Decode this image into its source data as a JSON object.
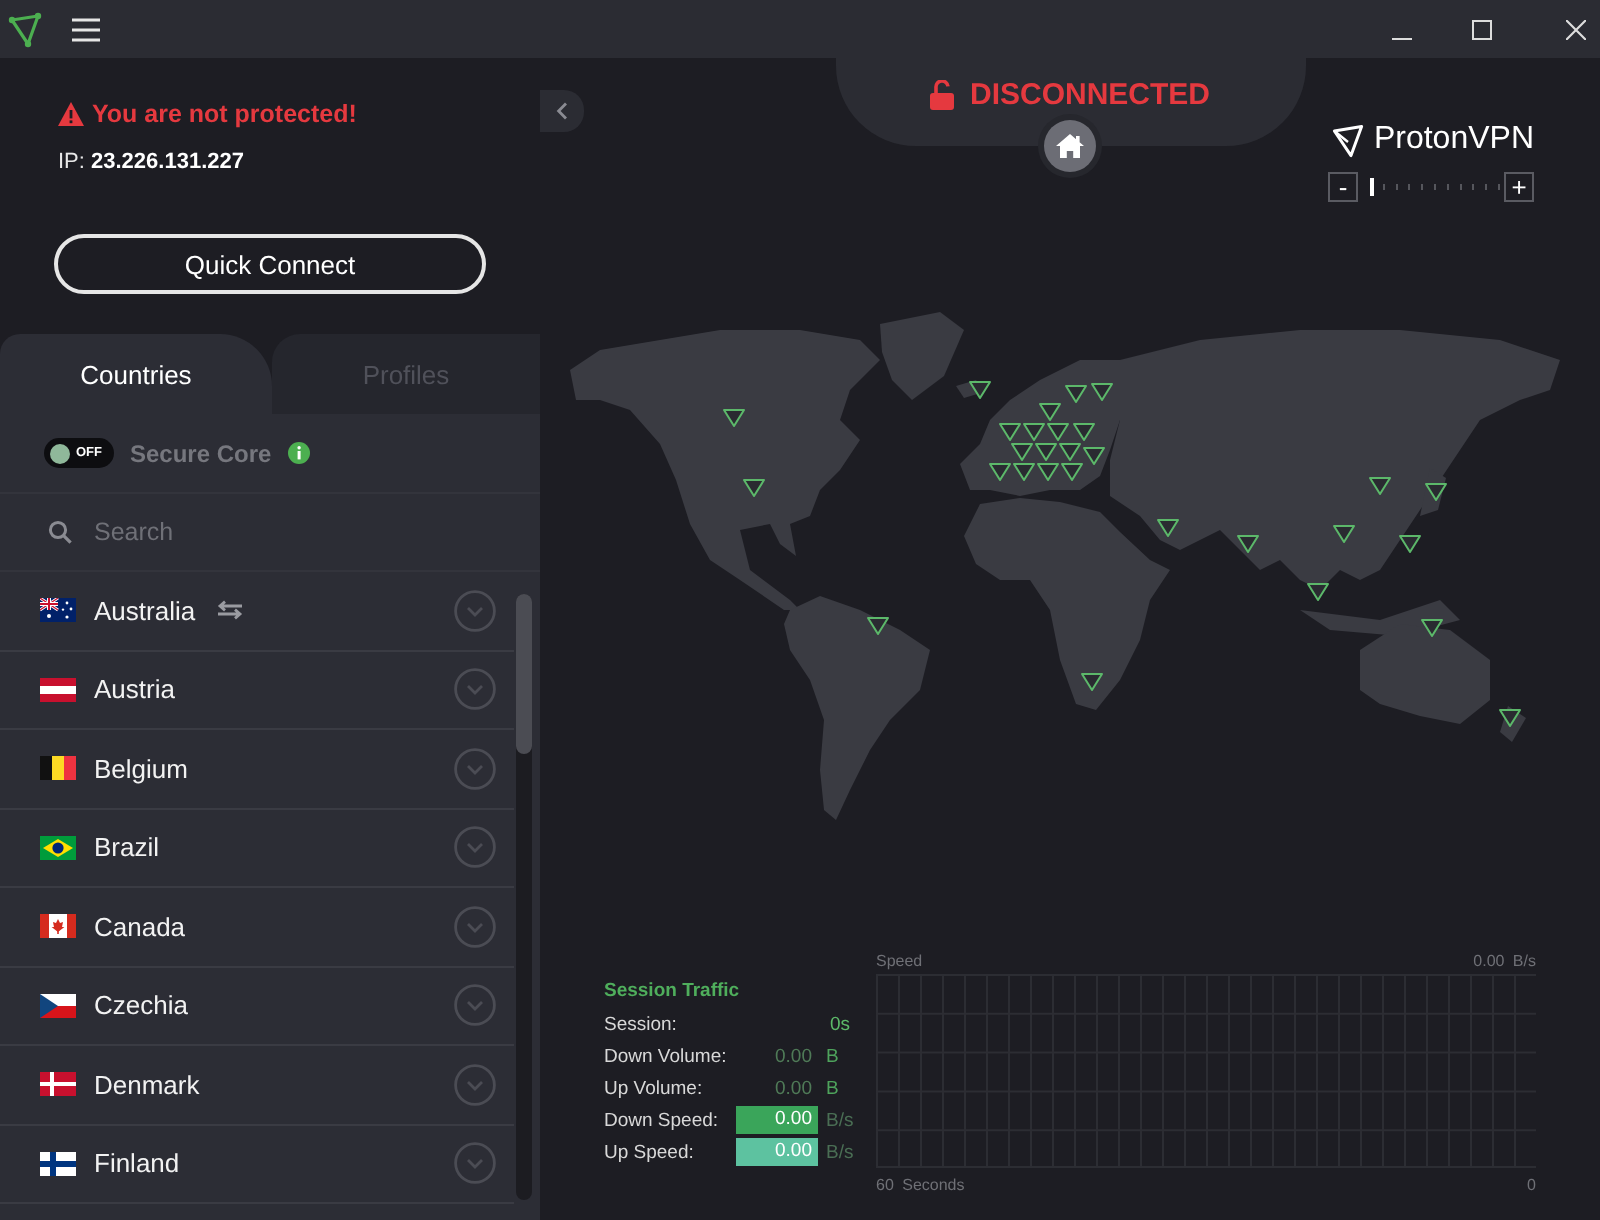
{
  "sidebar": {
    "warning": "You are not protected!",
    "ip": "IP: **23.226.131.227**",
    "quick_connect": "Quick Connect"
  },
  "tabs": [
    {
      "label": "Countries",
      "selected": true
    },
    {
      "label": "Profiles",
      "selected": false
    }
  ],
  "secure_core": {
    "label": "Secure Core",
    "on": false,
    "toggle_text": "OFF"
  },
  "search": {
    "placeholder": "Search"
  },
  "countries": [
    {
      "name": "Australia",
      "kind": "au",
      "feature_icon": true
    },
    {
      "name": "Austria",
      "kind": "at",
      "feature_icon": false
    },
    {
      "name": "Belgium",
      "kind": "be",
      "feature_icon": false
    },
    {
      "name": "Brazil",
      "kind": "br",
      "feature_icon": false
    },
    {
      "name": "Canada",
      "kind": "ca",
      "feature_icon": false
    },
    {
      "name": "Czechia",
      "kind": "cz",
      "feature_icon": false
    },
    {
      "name": "Denmark",
      "kind": "dk",
      "feature_icon": false
    },
    {
      "name": "Finland",
      "kind": "fi",
      "feature_icon": false
    }
  ],
  "connection": {
    "text": "DISCONNECTED",
    "connected": false
  },
  "brand": {
    "name": "ProtonVPN"
  },
  "map_zoom": {
    "minus": "-",
    "plus": "+",
    "level": 0
  },
  "session_traffic": {
    "title": "Session Traffic",
    "rows": [
      {
        "label": "Session:",
        "value": "0s",
        "kind": "time"
      },
      {
        "label": "Down Volume:",
        "value": "0.00",
        "unit": "B",
        "kind": "volume"
      },
      {
        "label": "Up Volume:",
        "value": "0.00",
        "unit": "B",
        "kind": "volume"
      },
      {
        "label": "Down Speed:",
        "value": "0.00",
        "unit": "B/s",
        "kind": "speed",
        "color": "#3aa55a"
      },
      {
        "label": "Up Speed:",
        "value": "0.00",
        "unit": "B/s",
        "kind": "speed",
        "color": "#5dc2a0"
      }
    ]
  },
  "speed_graph": {
    "title": "Speed",
    "max_label": "0.00 B/s",
    "time_label": "60 Seconds",
    "min_label": "0"
  }
}
